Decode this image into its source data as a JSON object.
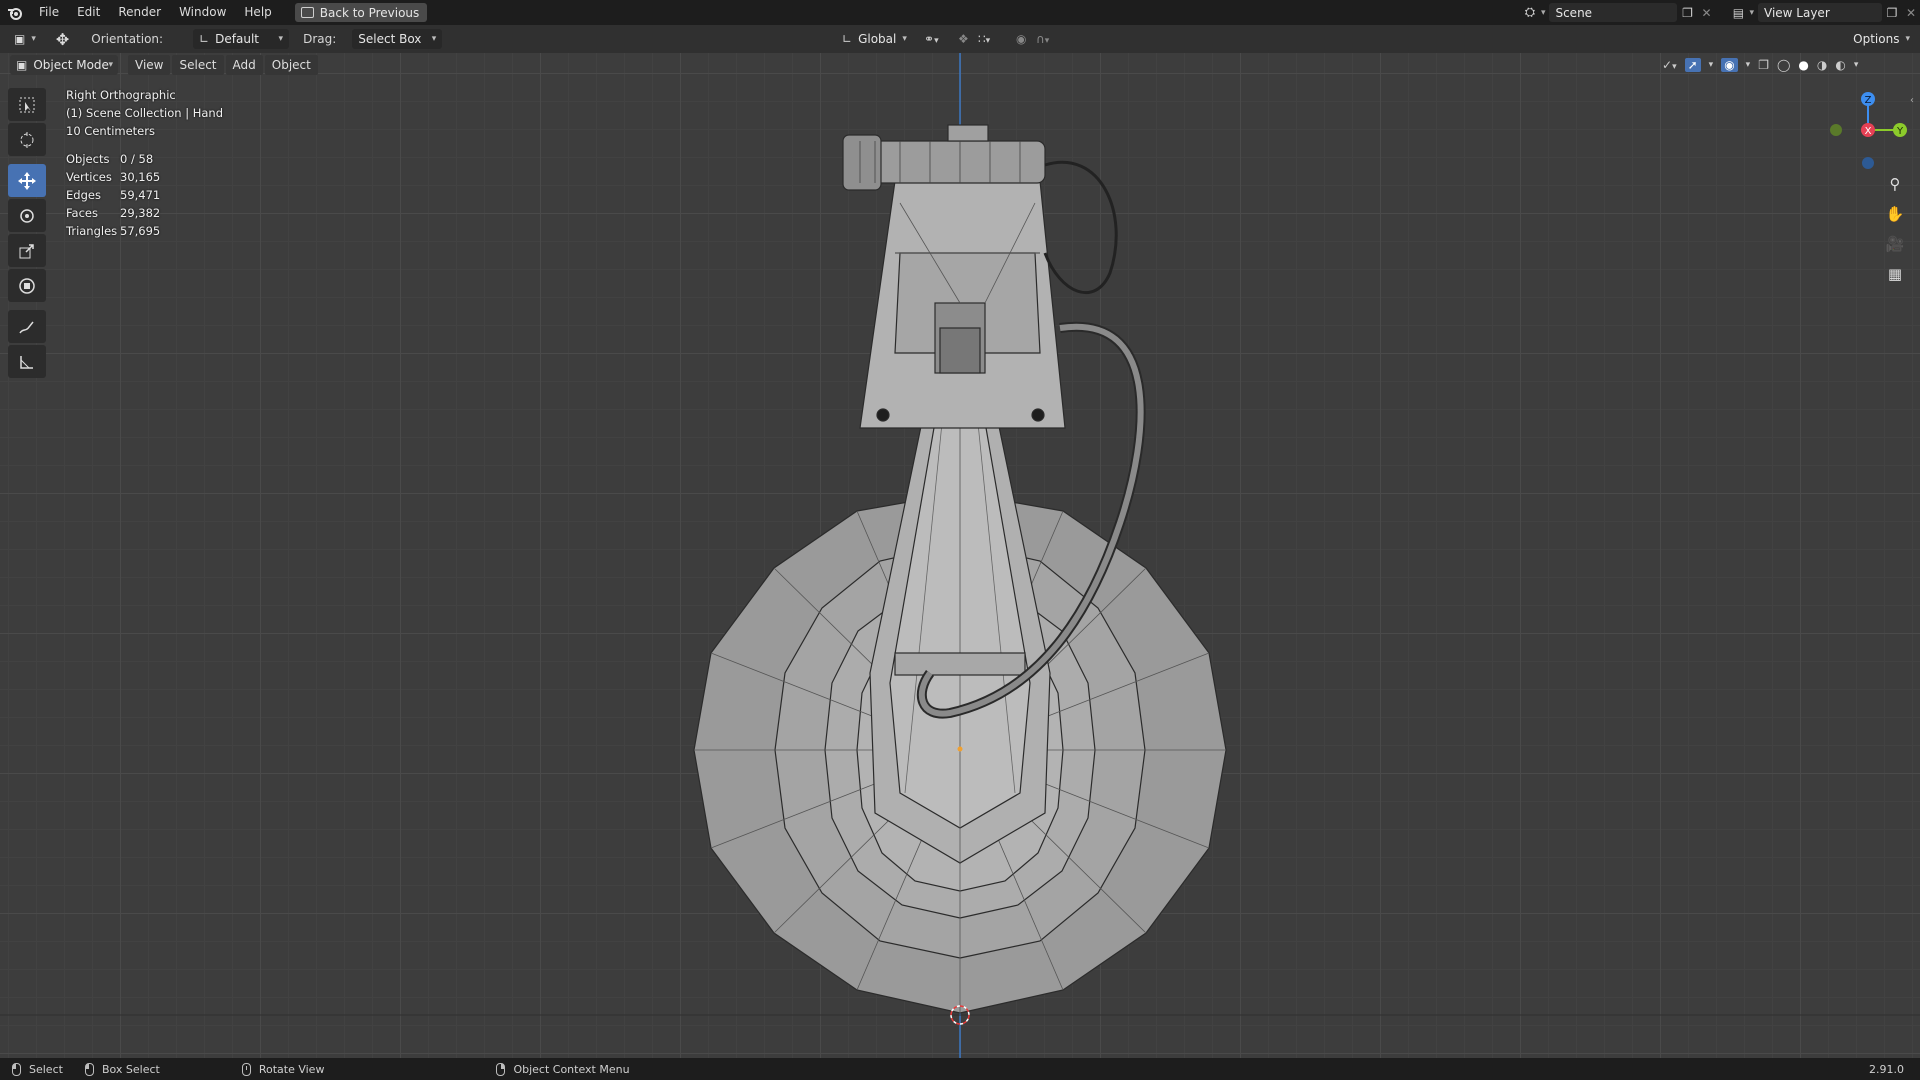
{
  "menu": {
    "items": [
      "File",
      "Edit",
      "Render",
      "Window",
      "Help"
    ],
    "back_label": "Back to Previous"
  },
  "top_right": {
    "scene_label": "Scene",
    "view_layer_label": "View Layer"
  },
  "header": {
    "orientation_label": "Orientation:",
    "orientation_value": "Default",
    "drag_label": "Drag:",
    "drag_value": "Select Box",
    "transform_space": "Global",
    "options_label": "Options"
  },
  "viewport_header": {
    "mode": "Object Mode",
    "menus": [
      "View",
      "Select",
      "Add",
      "Object"
    ]
  },
  "overlay": {
    "view_name": "Right Orthographic",
    "collection": "(1) Scene Collection | Hand",
    "scale": "10 Centimeters"
  },
  "stats": [
    {
      "label": "Objects",
      "value": "0 / 58"
    },
    {
      "label": "Vertices",
      "value": "30,165"
    },
    {
      "label": "Edges",
      "value": "59,471"
    },
    {
      "label": "Faces",
      "value": "29,382"
    },
    {
      "label": "Triangles",
      "value": "57,695"
    }
  ],
  "gizmo": {
    "z": "Z",
    "x": "X",
    "y": "Y",
    "colors": {
      "x": "#e64155",
      "y": "#8ccb2b",
      "z": "#3d8ef0"
    }
  },
  "status": {
    "select": "Select",
    "box_select": "Box Select",
    "rotate": "Rotate View",
    "context": "Object Context Menu",
    "version": "2.91.0"
  },
  "tools": [
    "select-box-tool",
    "cursor-tool",
    "move-tool",
    "rotate-tool",
    "scale-tool",
    "transform-tool",
    "annotate-tool",
    "measure-tool"
  ],
  "colors": {
    "accent": "#4772b3",
    "viewport_bg": "#3d3d3d",
    "header_bg": "#303030"
  }
}
